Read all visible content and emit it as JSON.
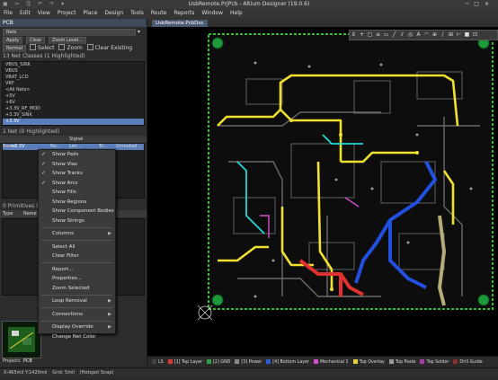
{
  "app": {
    "title": "UsbRemote.PrjPcb - Altium Designer (19.0.6)",
    "quick_access": "▣ ✂ ⎘ ↶ ↷ ▾"
  },
  "menu": [
    "File",
    "Edit",
    "View",
    "Project",
    "Place",
    "Design",
    "Tools",
    "Route",
    "Reports",
    "Window",
    "Help"
  ],
  "panel": {
    "title": "PCB",
    "mode": "Nets",
    "apply": "Apply",
    "clear": "Clear",
    "zoom_level": "Zoom Level...",
    "normal": "Normal",
    "select": "Select",
    "zoom": "Zoom",
    "clear_existing": "Clear Existing",
    "net_classes_header": "13 Net Classes (1 Highlighted)",
    "net_classes": [
      "VBUS_SINK",
      "VBUS",
      "VBAT_LCD",
      "VRF",
      "<All Nets>",
      "+5V",
      "+6V",
      "+3.3V_RF_MOD",
      "+3.3V_SINK",
      "+3.3V"
    ],
    "selected_class": "+3.3V",
    "net_header": "1 Net (0 Highlighted)",
    "net_columns": [
      "Name",
      "No...",
      "Signal Len...",
      "To...",
      "Unrouted ..."
    ],
    "net_row": "+3.3V",
    "primitives_header": "0 Primitives (0 Hig...",
    "prim_columns": [
      "Type",
      "Name",
      "...ength"
    ],
    "bottom_tabs": [
      "Projects",
      "PCB"
    ]
  },
  "context_menu": [
    {
      "label": "Show Pads",
      "checked": true
    },
    {
      "label": "Show Vias",
      "checked": true
    },
    {
      "label": "Show Tracks",
      "checked": true
    },
    {
      "label": "Show Arcs",
      "checked": true
    },
    {
      "label": "Show Fills",
      "checked": false
    },
    {
      "label": "Show Regions",
      "checked": false
    },
    {
      "label": "Show Component Bodies",
      "checked": false
    },
    {
      "label": "Show Strings",
      "checked": false
    },
    {
      "sep": true
    },
    {
      "label": "Columns",
      "sub": true
    },
    {
      "sep": true
    },
    {
      "label": "Select All"
    },
    {
      "label": "Clear Filter"
    },
    {
      "sep": true
    },
    {
      "label": "Report..."
    },
    {
      "label": "Properties..."
    },
    {
      "label": "Zoom Selected"
    },
    {
      "sep": true
    },
    {
      "label": "Loop Removal",
      "sub": true
    },
    {
      "sep": true
    },
    {
      "label": "Connections",
      "sub": true
    },
    {
      "sep": true
    },
    {
      "label": "Display Override",
      "sub": true
    },
    {
      "label": "Change Net Color"
    }
  ],
  "doc_tab": "UsbRemote.PcbDoc",
  "layers": [
    {
      "label": "LS",
      "color": "#444444"
    },
    {
      "label": "[1] Top Layer",
      "color": "#d93a3a"
    },
    {
      "label": "[2] GND",
      "color": "#2f9e44"
    },
    {
      "label": "[3] Power",
      "color": "#8a8a8a"
    },
    {
      "label": "[4] Bottom Layer",
      "color": "#2f5bd9"
    },
    {
      "label": "Mechanical 1",
      "color": "#d14fd1"
    },
    {
      "label": "Top Overlay",
      "color": "#e6d23a"
    },
    {
      "label": "Top Paste",
      "color": "#9a9a9a"
    },
    {
      "label": "Top Solder",
      "color": "#a83da8"
    },
    {
      "label": "Drill Guide",
      "color": "#8a3030"
    },
    {
      "label": "Keep-Out Layer",
      "color": "#c94fc9"
    },
    {
      "label": "Drill Drawing",
      "color": "#e04040"
    }
  ],
  "status": [
    "X:465mil Y:1420mil",
    "Grid: 5mil",
    "(Hotspot Snap)"
  ]
}
